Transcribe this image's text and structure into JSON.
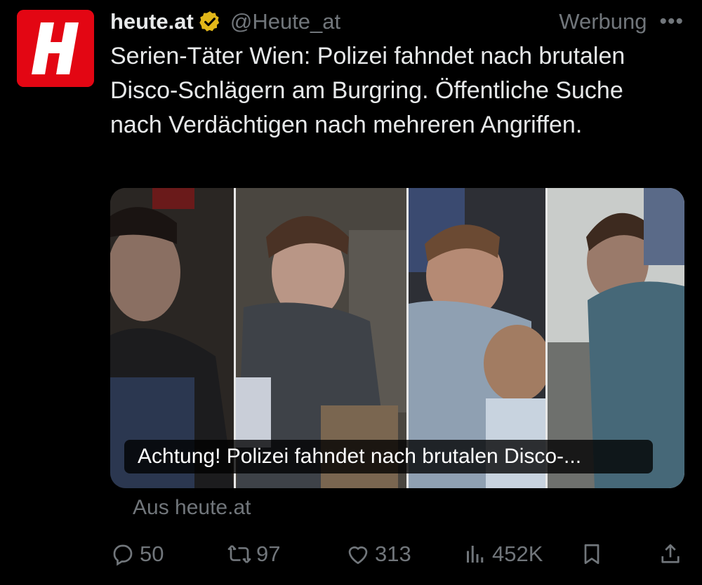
{
  "colors": {
    "background": "#000000",
    "text": "#e7e9ea",
    "muted": "#71767b",
    "brand_red": "#e30613",
    "verified_gold": "#e2b719"
  },
  "post": {
    "avatar_icon": "heute-logo",
    "display_name": "heute.at",
    "verified_icon": "verified-gold-badge-icon",
    "handle": "@Heute_at",
    "ad_label": "Werbung",
    "more_icon": "more-dots-icon",
    "text": "Serien-Täter Wien: Polizei fahndet nach brutalen Disco-Schlägern am Burgring. Öffentliche Suche nach Verdächtigen nach mehreren Angriffen.",
    "media": {
      "caption": "Achtung! Polizei fahndet nach brutalen Disco-..."
    },
    "source": "Aus heute.at"
  },
  "actions": {
    "replies": "50",
    "reposts": "97",
    "likes": "313",
    "views": "452K"
  }
}
